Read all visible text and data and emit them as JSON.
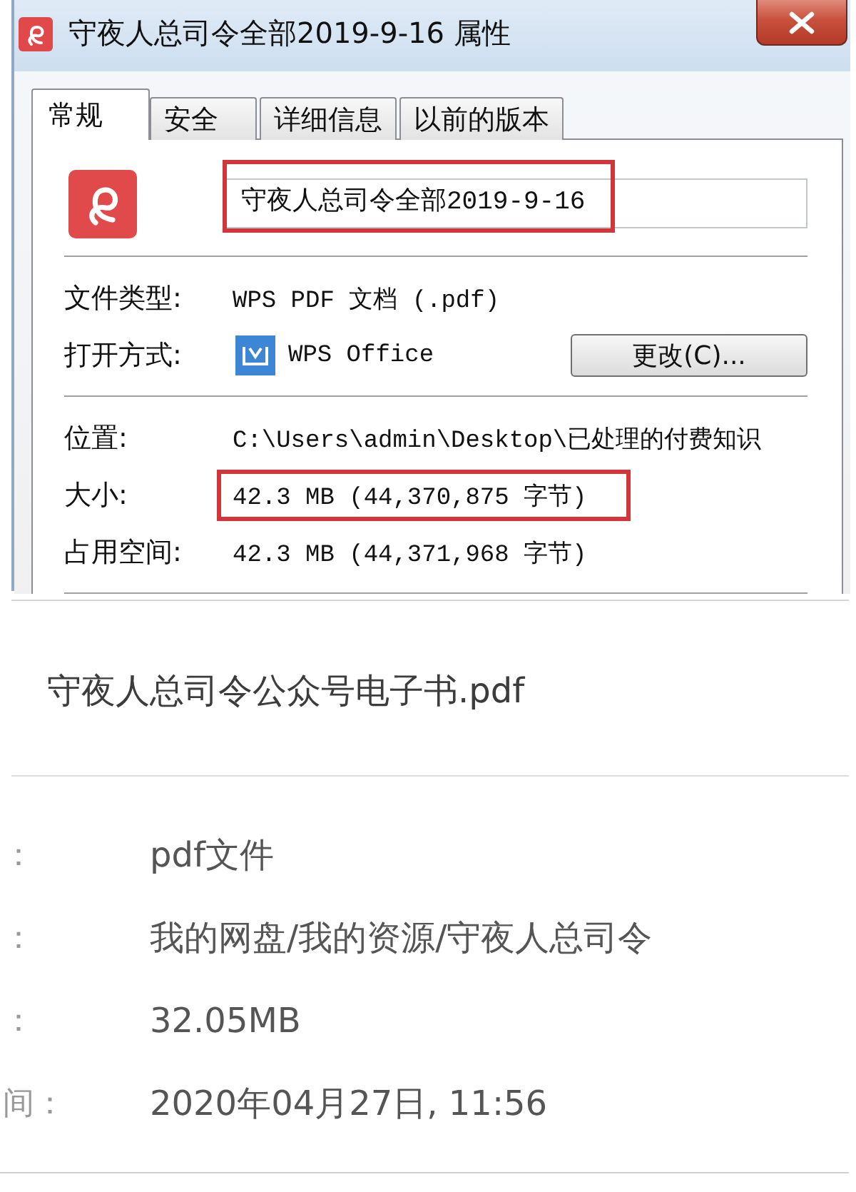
{
  "window": {
    "title": "守夜人总司令全部2019-9-16 属性"
  },
  "tabs": [
    {
      "label": "常规",
      "selected": true
    },
    {
      "label": "安全",
      "selected": false
    },
    {
      "label": "详细信息",
      "selected": false
    },
    {
      "label": "以前的版本",
      "selected": false
    }
  ],
  "general": {
    "name_field": {
      "value": "守夜人总司令全部2019-9-16",
      "highlighted": true
    },
    "groups": [
      [
        {
          "kind": "text",
          "label": "文件类型:",
          "value": "WPS PDF 文档 (.pdf)",
          "highlighted": false
        },
        {
          "kind": "app",
          "label": "打开方式:",
          "value": "WPS Office",
          "button": "更改(C)...",
          "highlighted": false
        }
      ],
      [
        {
          "kind": "text",
          "label": "位置:",
          "value": "C:\\Users\\admin\\Desktop\\已处理的付费知识",
          "highlighted": false
        },
        {
          "kind": "text",
          "label": "大小:",
          "value": "42.3 MB (44,370,875 字节)",
          "highlighted": true
        },
        {
          "kind": "text",
          "label": "占用空间:",
          "value": "42.3 MB (44,371,968 字节)",
          "highlighted": false
        }
      ]
    ]
  },
  "cloud_file": {
    "name": "守夜人总司令公众号电子书.pdf",
    "details": [
      {
        "label": "：",
        "value": "pdf文件"
      },
      {
        "label": "：",
        "value": "我的网盘/我的资源/守夜人总司令"
      },
      {
        "label": "：",
        "value": "32.05MB"
      },
      {
        "label": "间：",
        "value": "2020年04月27日, 11:56"
      }
    ]
  }
}
